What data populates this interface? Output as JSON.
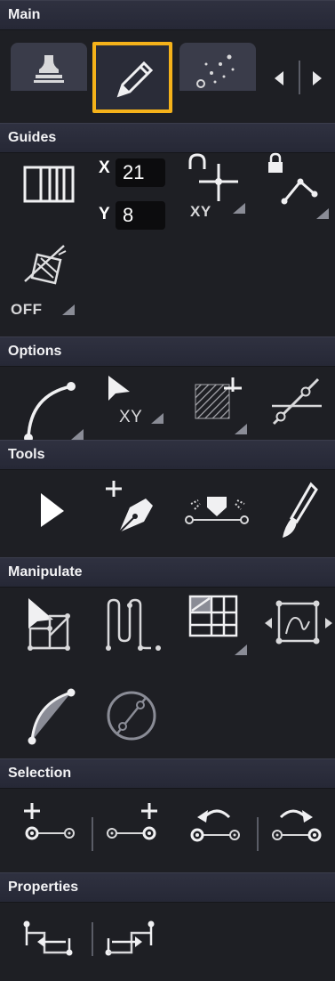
{
  "headers": {
    "main": "Main",
    "guides": "Guides",
    "options": "Options",
    "tools": "Tools",
    "manipulate": "Manipulate",
    "selection": "Selection",
    "properties": "Properties"
  },
  "guides": {
    "x_label": "X",
    "x_value": "21",
    "y_label": "Y",
    "y_value": "8",
    "xy_label": "XY",
    "off_label": "OFF"
  },
  "options": {
    "xy_label": "XY"
  },
  "colors": {
    "accent": "#f5b21a",
    "panel": "#1e1f24",
    "header": "#2b2d3b"
  }
}
